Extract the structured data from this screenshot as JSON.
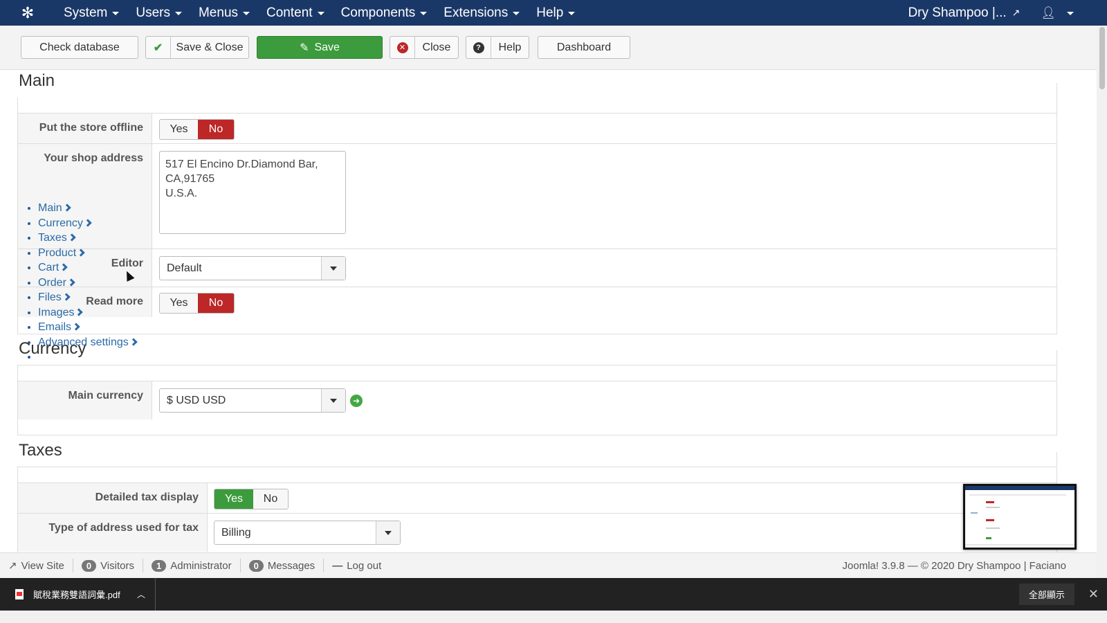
{
  "nav": {
    "items": [
      "System",
      "Users",
      "Menus",
      "Content",
      "Components",
      "Extensions",
      "Help"
    ],
    "site_label": "Dry Shampoo |...",
    "logo_icon": "joomla-logo-icon",
    "user_icon": "user-icon"
  },
  "toolbar": {
    "check_database": "Check database",
    "save_close": "Save & Close",
    "save": "Save",
    "close": "Close",
    "help": "Help",
    "dashboard": "Dashboard"
  },
  "sections": {
    "main": {
      "title": "Main",
      "store_offline_label": "Put the store offline",
      "store_offline_yes": "Yes",
      "store_offline_no": "No",
      "shop_address_label": "Your shop address",
      "shop_address_value": "517 El Encino Dr.Diamond Bar,\nCA,91765\nU.S.A.",
      "editor_label": "Editor",
      "editor_value": "Default",
      "read_more_label": "Read more",
      "read_more_yes": "Yes",
      "read_more_no": "No"
    },
    "currency": {
      "title": "Currency",
      "main_currency_label": "Main currency",
      "main_currency_value": "$ USD USD"
    },
    "taxes": {
      "title": "Taxes",
      "detailed_tax_label": "Detailed tax display",
      "detailed_tax_yes": "Yes",
      "detailed_tax_no": "No",
      "address_type_label": "Type of address used for tax",
      "address_type_value": "Billing"
    }
  },
  "sidenav": {
    "items": [
      "Main",
      "Currency",
      "Taxes",
      "Product",
      "Cart",
      "Order",
      "Files",
      "Images",
      "Emails",
      "Advanced settings"
    ]
  },
  "status": {
    "view_site": "View Site",
    "visitors_count": "0",
    "visitors_label": "Visitors",
    "admin_count": "1",
    "admin_label": "Administrator",
    "messages_count": "0",
    "messages_label": "Messages",
    "logout": "Log out",
    "copyright": "Joomla! 3.9.8 — © 2020 Dry Shampoo | Faciano"
  },
  "shelf": {
    "file_name": "賦稅業務雙語詞彙.pdf",
    "show_all": "全部顯示"
  },
  "colors": {
    "navbar": "#1a3867",
    "save_green": "#3c9b3c",
    "toggle_red": "#bd2727",
    "link_blue": "#2a6aa8"
  }
}
